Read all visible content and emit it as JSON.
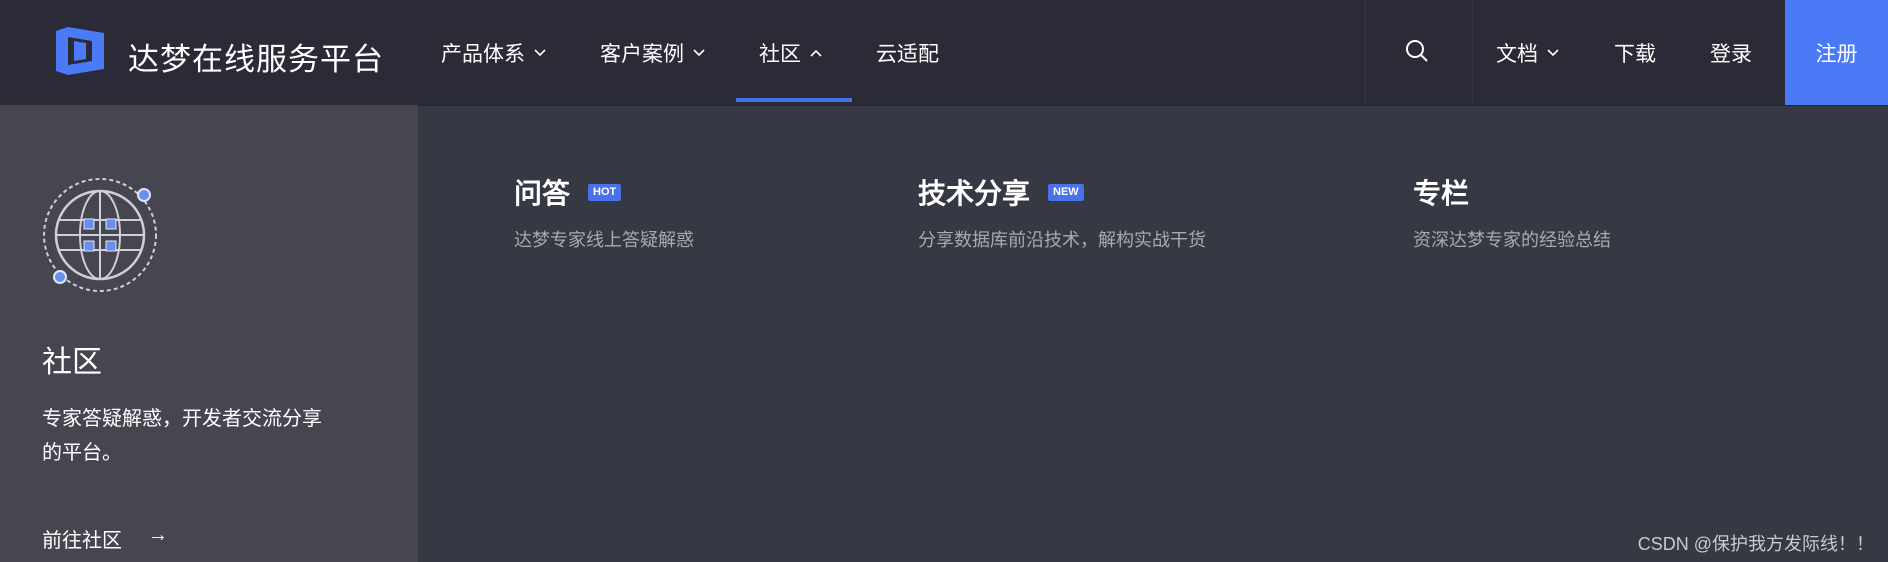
{
  "header": {
    "brand": "达梦在线服务平台",
    "nav": [
      {
        "label": "产品体系"
      },
      {
        "label": "客户案例"
      },
      {
        "label": "社区"
      },
      {
        "label": "云适配"
      }
    ],
    "docs_label": "文档",
    "download_label": "下载",
    "login_label": "登录",
    "register_label": "注册",
    "accent_color": "#4a72e8"
  },
  "side_panel": {
    "title": "社区",
    "description": "专家答疑解惑，开发者交流分享的平台。",
    "link_label": "前往社区",
    "link_arrow": "→"
  },
  "menu": [
    {
      "title": "问答",
      "badge": "HOT",
      "description": "达梦专家线上答疑解惑"
    },
    {
      "title": "技术分享",
      "badge": "NEW",
      "description": "分享数据库前沿技术，解构实战干货"
    },
    {
      "title": "专栏",
      "description": "资深达梦专家的经验总结"
    }
  ],
  "watermark": "CSDN @保护我方发际线！！"
}
